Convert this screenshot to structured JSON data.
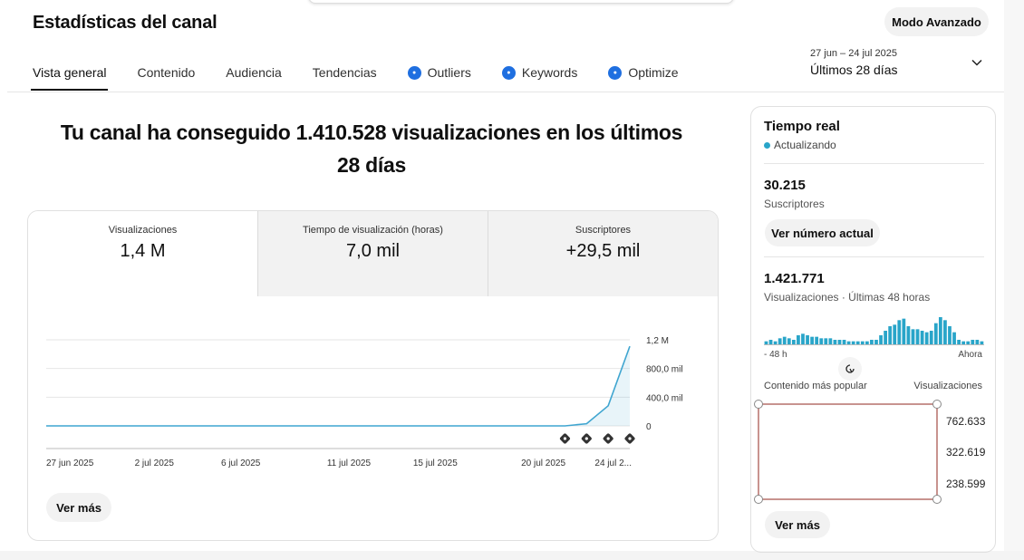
{
  "header": {
    "title": "Estadísticas del canal",
    "mode_button": "Modo Avanzado"
  },
  "tabs": [
    {
      "label": "Vista general",
      "active": true,
      "icon": ""
    },
    {
      "label": "Contenido",
      "active": false,
      "icon": ""
    },
    {
      "label": "Audiencia",
      "active": false,
      "icon": ""
    },
    {
      "label": "Tendencias",
      "active": false,
      "icon": ""
    },
    {
      "label": "Outliers",
      "active": false,
      "icon": "extension-badge-icon"
    },
    {
      "label": "Keywords",
      "active": false,
      "icon": "extension-badge-icon"
    },
    {
      "label": "Optimize",
      "active": false,
      "icon": "extension-badge-icon"
    }
  ],
  "date_range": {
    "dates": "27 jun – 24 jul 2025",
    "label": "Últimos 28 días",
    "icon": "chevron-down-icon"
  },
  "headline": "Tu canal ha conseguido 1.410.528 visualizaciones en los últimos 28 días",
  "metrics": [
    {
      "label": "Visualizaciones",
      "value": "1,4 M"
    },
    {
      "label": "Tiempo de visualización (horas)",
      "value": "7,0 mil"
    },
    {
      "label": "Suscriptores",
      "value": "+29,5 mil"
    }
  ],
  "chart_data": {
    "type": "area",
    "x": [
      "27 jun 2025",
      "28 jun",
      "29 jun",
      "30 jun",
      "1 jul",
      "2 jul 2025",
      "3 jul",
      "4 jul",
      "5 jul",
      "6 jul 2025",
      "7 jul",
      "8 jul",
      "9 jul",
      "10 jul",
      "11 jul 2025",
      "12 jul",
      "13 jul",
      "14 jul",
      "15 jul 2025",
      "16 jul",
      "17 jul",
      "18 jul",
      "19 jul",
      "20 jul 2025",
      "21 jul",
      "22 jul",
      "23 jul",
      "24 jul"
    ],
    "values": [
      0,
      0,
      0,
      0,
      0,
      0,
      0,
      0,
      0,
      0,
      0,
      0,
      0,
      0,
      0,
      0,
      0,
      0,
      0,
      0,
      0,
      0,
      0,
      0,
      0,
      30000,
      280000,
      1110000
    ],
    "x_tick_labels": [
      "27 jun 2025",
      "2 jul 2025",
      "6 jul 2025",
      "11 jul 2025",
      "15 jul 2025",
      "20 jul 2025",
      "24 jul 2..."
    ],
    "x_tick_index": [
      0,
      5,
      9,
      14,
      18,
      23,
      27
    ],
    "y_tick_labels": [
      "0",
      "400,0 mil",
      "800,0 mil",
      "1,2 M"
    ],
    "ylim": [
      0,
      1200000
    ],
    "color": "#3fa5d0",
    "markers": {
      "icon": "video-publish-icon",
      "indices": [
        24,
        25,
        26,
        27
      ]
    }
  },
  "main_more_button": "Ver más",
  "realtime": {
    "title": "Tiempo real",
    "status": "Actualizando",
    "subscribers": "30.215",
    "subscribers_label": "Suscriptores",
    "current_button": "Ver número actual",
    "views": "1.421.771",
    "views_label": "Visualizaciones · Últimas 48 horas",
    "spark_values": [
      2,
      3,
      2,
      4,
      5,
      4,
      3,
      6,
      7,
      6,
      5,
      5,
      4,
      4,
      4,
      3,
      3,
      3,
      2,
      2,
      2,
      2,
      2,
      3,
      3,
      6,
      9,
      12,
      13,
      16,
      17,
      12,
      10,
      10,
      9,
      8,
      9,
      14,
      18,
      16,
      12,
      8,
      3,
      2,
      2,
      3,
      3,
      2
    ],
    "spark_left": "- 48 h",
    "spark_right": "Ahora",
    "popular_label": "Contenido más popular",
    "popular_metric": "Visualizaciones",
    "popular_values": [
      "762.633",
      "322.619",
      "238.599"
    ],
    "more_button": "Ver más",
    "accent": "#29a5c9"
  }
}
